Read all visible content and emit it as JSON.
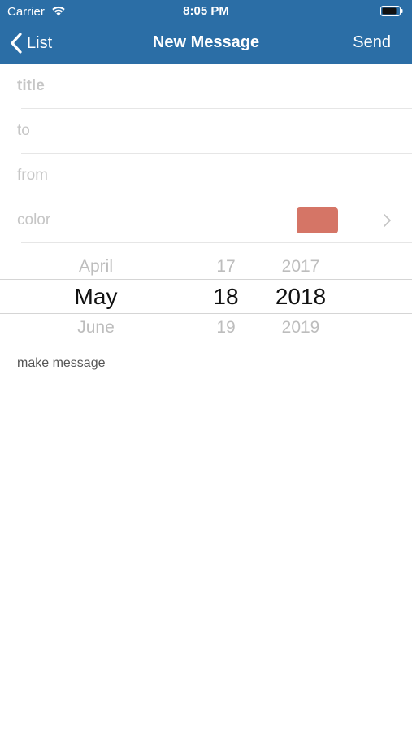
{
  "status": {
    "carrier": "Carrier",
    "time": "8:05 PM"
  },
  "nav": {
    "back_label": "List",
    "title": "New Message",
    "send_label": "Send"
  },
  "form": {
    "title_placeholder": "title",
    "to_placeholder": "to",
    "from_placeholder": "from",
    "color_label": "color",
    "color_value": "#d57566"
  },
  "date_picker": {
    "month": {
      "prev": "April",
      "selected": "May",
      "next": "June"
    },
    "day": {
      "prev": "17",
      "selected": "18",
      "next": "19"
    },
    "year": {
      "prev": "2017",
      "selected": "2018",
      "next": "2019"
    }
  },
  "make_message_label": "make message",
  "colors": {
    "nav_bar": "#2b6ea6"
  }
}
